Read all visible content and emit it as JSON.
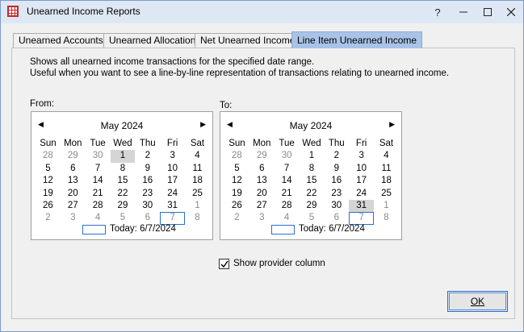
{
  "window": {
    "title": "Unearned Income Reports",
    "help_label": "?",
    "controls": {
      "minimize": "–",
      "maximize": "☐",
      "close": "✕"
    }
  },
  "tabs": [
    {
      "label": "Unearned Accounts",
      "active": false
    },
    {
      "label": "Unearned Allocation",
      "active": false
    },
    {
      "label": "Net Unearned Income",
      "active": false
    },
    {
      "label": "Line Item Unearned Income",
      "active": true
    }
  ],
  "description": {
    "line1": "Shows all unearned income transactions for the specified date range.",
    "line2": "Useful when you want to see a line-by-line representation of transactions relating to unearned income."
  },
  "from_label": "From:",
  "to_label": "To:",
  "calendar_common": {
    "month_title": "May 2024",
    "prev_icon": "◀",
    "next_icon": "▶",
    "weekdays": [
      "Sun",
      "Mon",
      "Tue",
      "Wed",
      "Thu",
      "Fri",
      "Sat"
    ],
    "weeks": [
      [
        "28",
        "29",
        "30",
        "1",
        "2",
        "3",
        "4"
      ],
      [
        "5",
        "6",
        "7",
        "8",
        "9",
        "10",
        "11"
      ],
      [
        "12",
        "13",
        "14",
        "15",
        "16",
        "17",
        "18"
      ],
      [
        "19",
        "20",
        "21",
        "22",
        "23",
        "24",
        "25"
      ],
      [
        "26",
        "27",
        "28",
        "29",
        "30",
        "31",
        "1"
      ],
      [
        "2",
        "3",
        "4",
        "5",
        "6",
        "7",
        "8"
      ]
    ],
    "today_text": "Today: 6/7/2024"
  },
  "from_calendar": {
    "selected_day": "1"
  },
  "to_calendar": {
    "selected_day": "31"
  },
  "show_provider": {
    "label": "Show provider column",
    "checked": true
  },
  "ok_button": {
    "label": "OK"
  }
}
